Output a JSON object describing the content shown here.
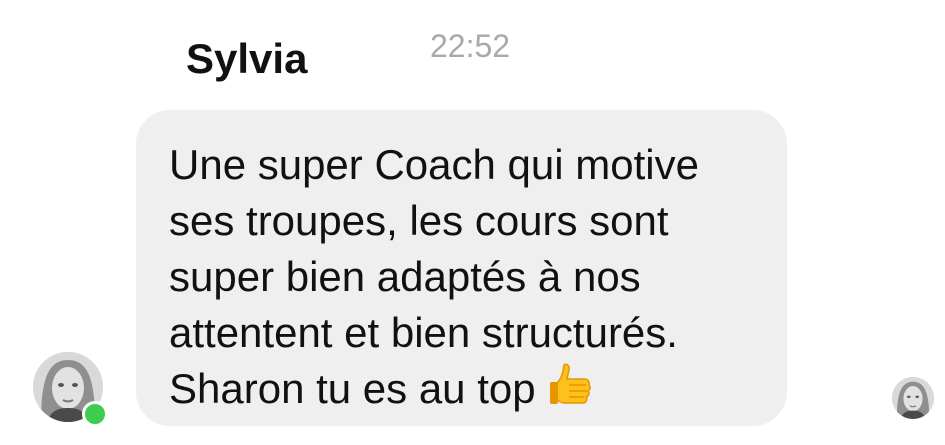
{
  "message": {
    "sender_name": "Sylvia",
    "time": "22:52",
    "lines": [
      "Une super Coach qui motive",
      "ses troupes, les cours sont",
      "super bien adaptés à nos",
      "attentent et bien structurés.",
      "Sharon tu es au top"
    ],
    "emoji": "thumbs-up-icon",
    "bubble_color": "#efefef",
    "online_status_color": "#3dcd4c",
    "sender_online": true
  },
  "avatars": {
    "sender": "avatar",
    "seen_receipt": "seen-avatar"
  }
}
